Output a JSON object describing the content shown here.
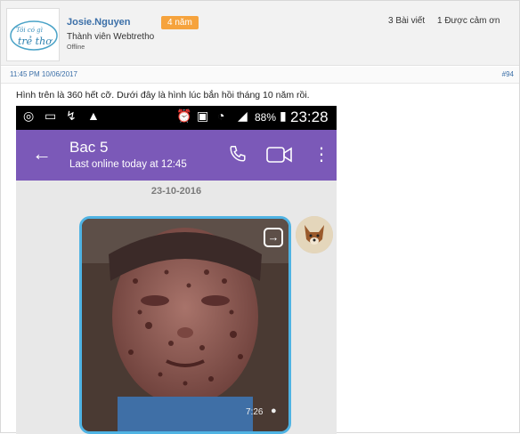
{
  "profile": {
    "username": "Josie.Nguyen",
    "badge": "4 năm",
    "role": "Thành viên Webtretho",
    "status": "Offline",
    "posts": "3 Bài viết",
    "thanks": "1 Được cảm ơn",
    "avatar_text_top": "Tôi có gì",
    "avatar_text_bottom": "trẻ thơ"
  },
  "meta": {
    "timestamp": "11:45 PM 10/06/2017",
    "post_number": "#94"
  },
  "post": {
    "text": "Hình trên là 360 hết cỡ. Dưới đây là hình lúc bắn hồi tháng 10 năm rồi."
  },
  "phone": {
    "battery": "88%",
    "clock": "23:28",
    "contact_name": "Bac 5",
    "last_online": "Last online today at 12:45",
    "date_separator": "23-10-2016",
    "photo_time": "7:26"
  },
  "colors": {
    "accent_link": "#3b6fa8",
    "badge": "#f6a33d",
    "viber_purple": "#7b59b8",
    "photo_border": "#4fb3e3"
  }
}
